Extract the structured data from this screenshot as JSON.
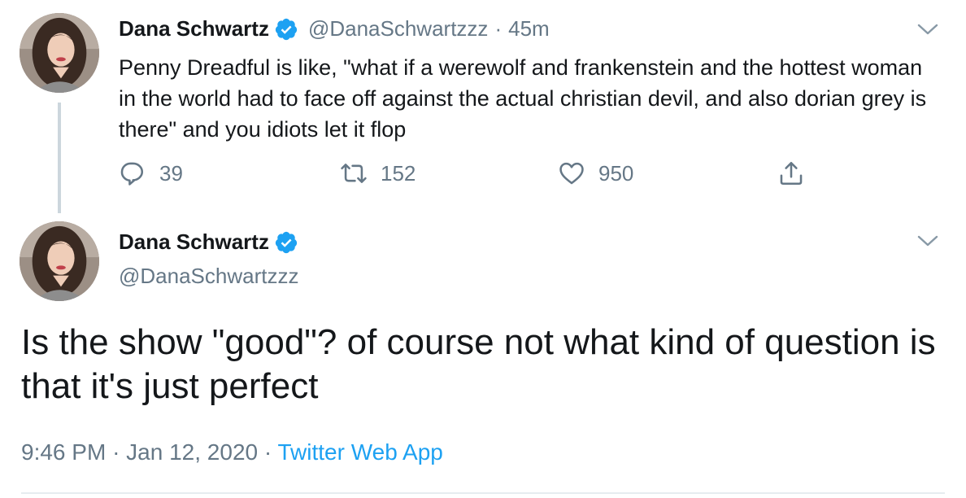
{
  "tweet1": {
    "name": "Dana Schwartz",
    "handle": "@DanaSchwartzzz",
    "separator": "·",
    "time": "45m",
    "text": "Penny Dreadful is like, \"what if a werewolf and frankenstein and the hottest woman in the world had to face off against the actual christian devil, and also dorian grey is there\" and you idiots let it flop",
    "replies": "39",
    "retweets": "152",
    "likes": "950"
  },
  "tweet2": {
    "name": "Dana Schwartz",
    "handle": "@DanaSchwartzzz",
    "text": "Is the show \"good\"? of course not what kind of question is that it's just perfect",
    "time": "9:46 PM",
    "separator": "·",
    "date": "Jan 12, 2020",
    "source": "Twitter Web App"
  },
  "colors": {
    "verified": "#1da1f2",
    "secondary_text": "#657786",
    "link": "#1da1f2",
    "thread_line": "#ccd6dd"
  },
  "icons": [
    "verified-badge-icon",
    "chevron-down-icon",
    "reply-icon",
    "retweet-icon",
    "like-icon",
    "share-icon"
  ]
}
